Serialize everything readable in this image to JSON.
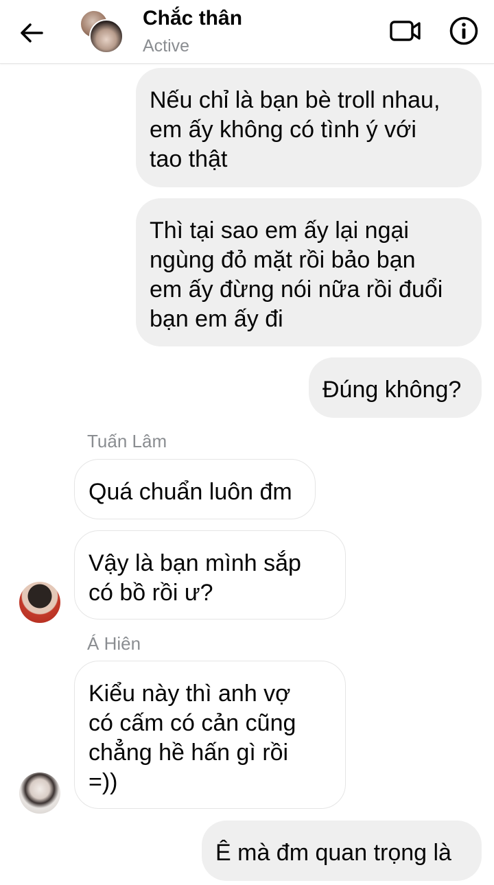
{
  "header": {
    "title": "Chắc thân",
    "status": "Active",
    "icons": {
      "back": "back-arrow-icon",
      "video": "video-call-icon",
      "info": "info-icon"
    }
  },
  "messages": [
    {
      "id": "m1",
      "direction": "outgoing",
      "text": "Nếu chỉ là bạn bè troll nhau,\nem ấy không có tình ý với\ntao thật"
    },
    {
      "id": "m2",
      "direction": "outgoing",
      "text": "Thì tại sao em ấy lại ngại\nngùng đỏ mặt rồi bảo bạn\nem ấy đừng nói nữa rồi đuổi\nbạn em ấy đi"
    },
    {
      "id": "m3",
      "direction": "outgoing",
      "text": "Đúng không?"
    },
    {
      "id": "m4",
      "direction": "incoming",
      "sender": "Tuấn Lâm",
      "text": "Quá chuẩn luôn đm"
    },
    {
      "id": "m5",
      "direction": "incoming",
      "text": "Vậy là bạn mình sắp\ncó bồ rồi ư?"
    },
    {
      "id": "m6",
      "direction": "incoming",
      "sender": "Á Hiên",
      "text": "Kiểu này thì anh vợ\ncó cấm có cản cũng\nchẳng hề hấn gì rồi\n=))"
    },
    {
      "id": "m7",
      "direction": "outgoing",
      "text": "Ê mà đm quan trọng là"
    }
  ],
  "colors": {
    "outgoing_bubble": "#efefef",
    "incoming_bubble": "#ffffff",
    "secondary_text": "#8a8d91",
    "primary_text": "#050505"
  }
}
